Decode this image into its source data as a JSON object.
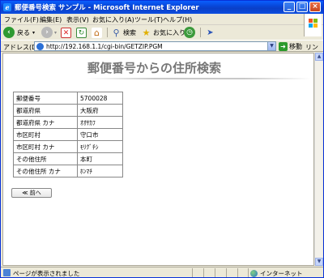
{
  "window": {
    "title": "郵便番号検索 サンプル - Microsoft Internet Explorer",
    "minimize": "_",
    "maximize": "□",
    "close": "×"
  },
  "menu": {
    "items": [
      "ファイル(F)",
      "編集(E)",
      "表示(V)",
      "お気に入り(A)",
      "ツール(T)",
      "ヘルプ(H)"
    ]
  },
  "toolbar": {
    "back_label": "戻る",
    "search_label": "検索",
    "favorites_label": "お気に入り"
  },
  "address": {
    "label": "アドレス(D)",
    "url": "http://192.168.1.1/cgi-bin/GETZIP.PGM",
    "go_label": "移動",
    "links_label": "リンク"
  },
  "page": {
    "title": "郵便番号からの住所検索",
    "rows": [
      {
        "label": "郵便番号",
        "value": "5700028"
      },
      {
        "label": "都道府県",
        "value": "大阪府"
      },
      {
        "label": "都道府県 カナ",
        "value": "ｵｵｻｶﾌ"
      },
      {
        "label": "市区町村",
        "value": "守口市"
      },
      {
        "label": "市区町村 カナ",
        "value": "ﾓﾘｸﾞﾁｼ"
      },
      {
        "label": "その他住所",
        "value": "本町"
      },
      {
        "label": "その他住所 カナ",
        "value": "ﾎﾝﾏﾁ"
      }
    ],
    "back_button": "≪ 前へ"
  },
  "status": {
    "text": "ページが表示されました",
    "zone": "インターネット"
  },
  "colors": {
    "titlebar": "#0846d8",
    "heading": "#767676"
  }
}
